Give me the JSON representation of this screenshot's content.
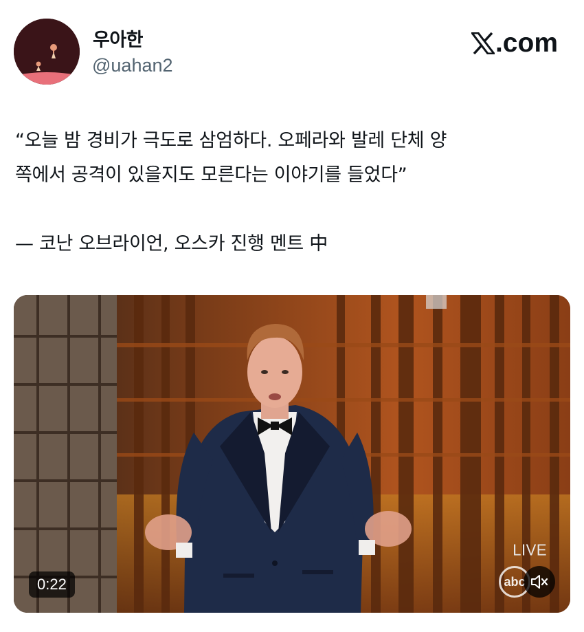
{
  "author": {
    "display_name": "우아한",
    "handle": "@uahan2"
  },
  "brand": {
    "label": ".com"
  },
  "tweet": {
    "line1": "“오늘 밤 경비가 극도로 삼엄하다. 오페라와 발레 단체 양",
    "line2": "쪽에서 공격이 있을지도 모른다는 이야기를 들었다”",
    "attribution": "— 코난 오브라이언, 오스카 진행 멘트 中"
  },
  "video": {
    "duration": "0:22",
    "live_label": "LIVE",
    "network_logo": "abc",
    "muted": true
  },
  "icons": {
    "brand": "x-logo-icon",
    "mute": "speaker-muted-icon"
  },
  "colors": {
    "text": "#0f1419",
    "secondary_text": "#536471",
    "media_bg": "#4a2512"
  }
}
